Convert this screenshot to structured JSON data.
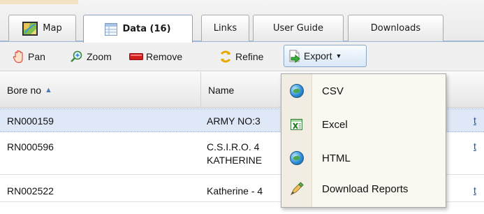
{
  "tabs": [
    {
      "label": "Map",
      "icon": "map-icon",
      "active": false
    },
    {
      "label": "Data (16)",
      "icon": "table-icon",
      "active": true
    },
    {
      "label": "Links",
      "active": false
    },
    {
      "label": "User Guide",
      "active": false
    },
    {
      "label": "Downloads",
      "active": false
    }
  ],
  "toolbar": {
    "pan": "Pan",
    "zoom": "Zoom",
    "remove": "Remove",
    "refine": "Refine",
    "export": "Export"
  },
  "grid": {
    "columns": [
      "Bore no",
      "Name"
    ],
    "sorted_column": "Bore no",
    "sort_direction": "ascending",
    "rows": [
      {
        "bore_no": "RN000159",
        "name": "ARMY NO:3",
        "selected": true
      },
      {
        "bore_no": "RN000596",
        "name": "C.S.I.R.O. 4",
        "name_line2": "KATHERINE",
        "selected": false
      },
      {
        "bore_no": "RN002522",
        "name": "Katherine - 4",
        "selected": false
      }
    ],
    "link_fragment": "t"
  },
  "export_menu": {
    "items": [
      {
        "label": "CSV",
        "icon": "globe-icon"
      },
      {
        "label": "Excel",
        "icon": "excel-icon"
      },
      {
        "label": "HTML",
        "icon": "globe-icon"
      },
      {
        "label": "Download Reports",
        "icon": "report-pen-icon"
      }
    ]
  },
  "colors": {
    "tab_underline": "#9fb8d6",
    "selected_row": "#dfe8f6",
    "menu_background": "#fbf8f1",
    "link": "#1f4ea8"
  }
}
